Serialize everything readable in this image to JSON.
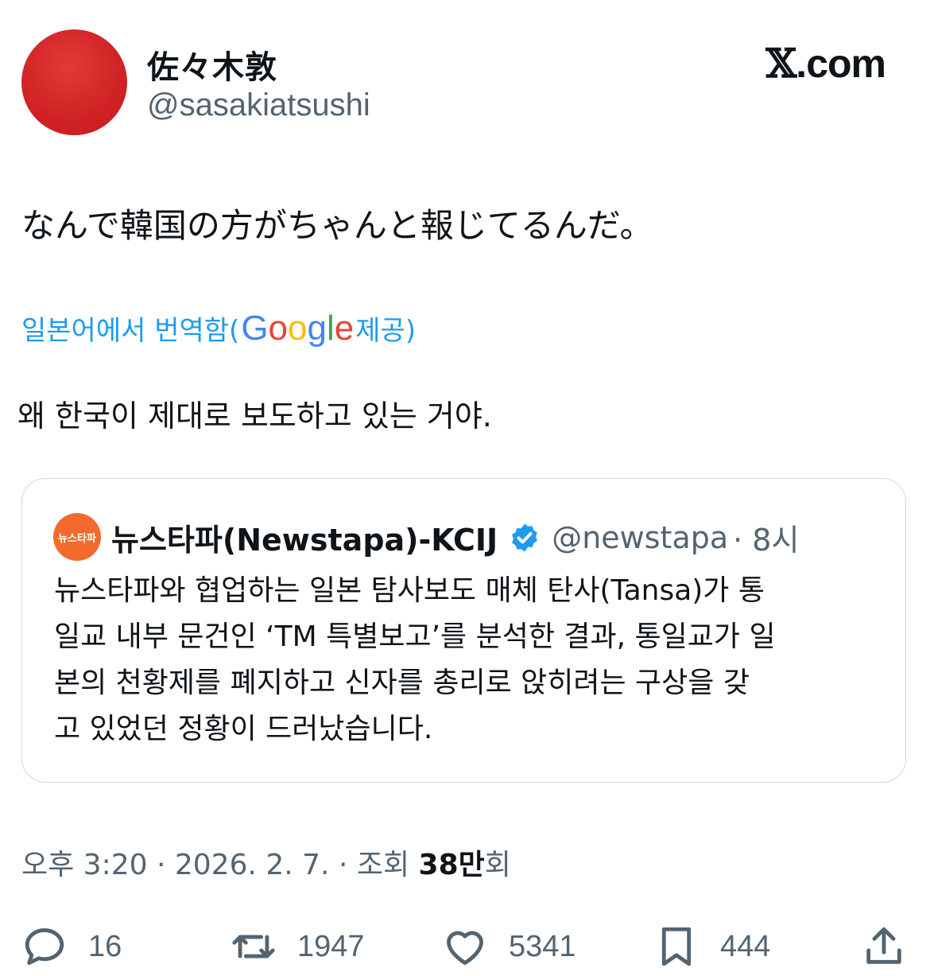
{
  "author": {
    "display_name": "佐々木敦",
    "handle": "@sasakiatsushi",
    "avatar_color": "#d02224"
  },
  "brand": {
    "x_mark": "𝕏",
    "suffix": ".com"
  },
  "tweet": {
    "text": "なんで韓国の方がちゃんと報じてるんだ。",
    "translate_prefix": "일본어에서 번역함(",
    "translate_google": [
      "G",
      "o",
      "o",
      "g",
      "l",
      "e"
    ],
    "translate_suffix": " 제공)",
    "translated_text": "왜 한국이 제대로 보도하고 있는 거야."
  },
  "quote": {
    "avatar_text": "뉴스타파",
    "avatar_color": "#f26b2d",
    "name": "뉴스타파(Newstapa)-KCIJ",
    "handle": "@newstapa",
    "time": "· 8시",
    "verified_color": "#1d9bf0",
    "lines": [
      "뉴스타파와 협업하는 일본 탐사보도 매체 탄사(Tansa)가 통",
      "일교 내부 문건인 ‘TM 특별보고’를 분석한 결과, 통일교가 일",
      "본의 천황제를 폐지하고 신자를 총리로 앉히려는 구상을 갖",
      "고 있었던 정황이 드러났습니다."
    ]
  },
  "meta": {
    "prefix": "오후 3:20 · 2026. 2. 7. · 조회 ",
    "views": "38만",
    "suffix": "회"
  },
  "actions": {
    "replies": "16",
    "reposts": "1947",
    "likes": "5341",
    "bookmarks": "444"
  },
  "icons": [
    "reply-icon",
    "repost-icon",
    "like-icon",
    "bookmark-icon",
    "share-icon",
    "verified-badge-icon"
  ]
}
